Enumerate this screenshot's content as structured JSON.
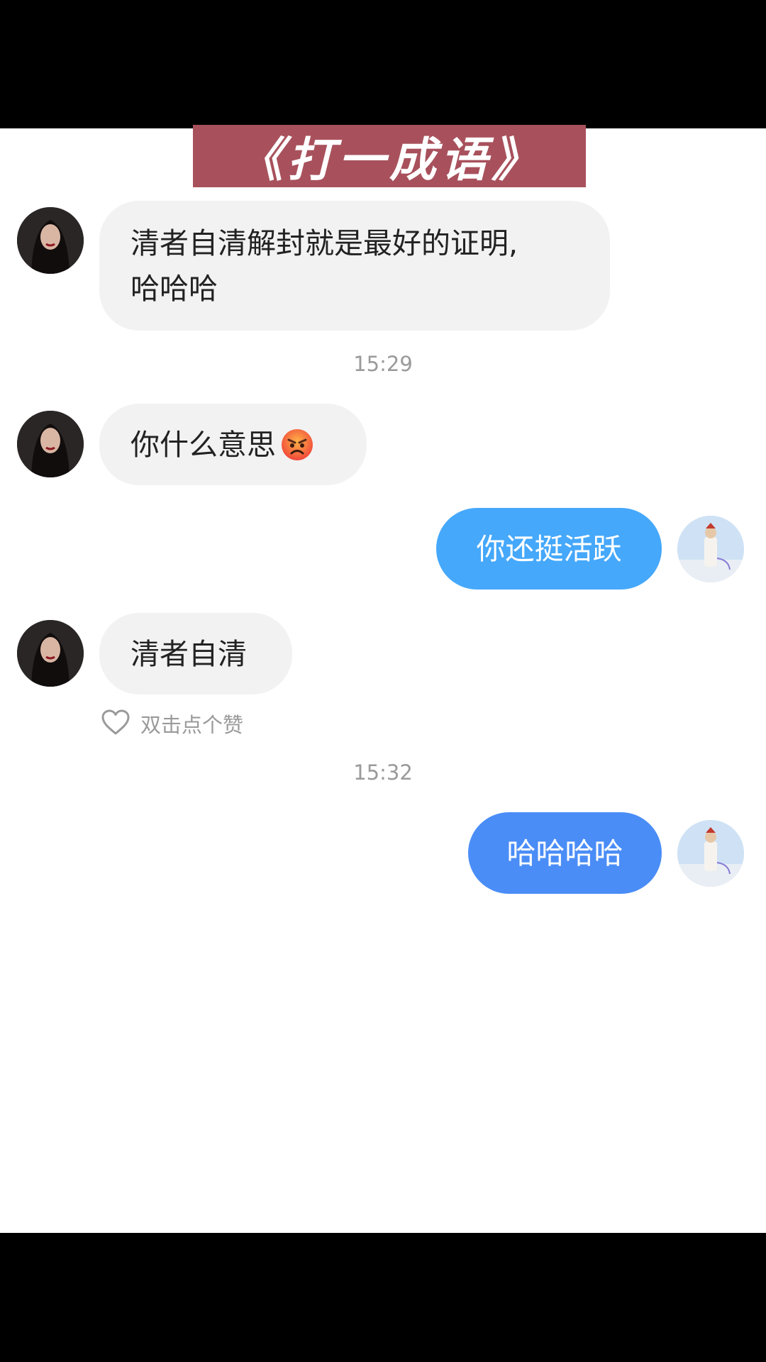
{
  "title": "《打一成语》",
  "colors": {
    "banner": "#a8515c",
    "incoming_bubble": "#f2f2f2",
    "outgoing_bubble_1": "#45a8fb",
    "outgoing_bubble_2": "#4a8df7",
    "timestamp": "#9a9a9a"
  },
  "messages": [
    {
      "side": "in",
      "line1": "清者自清解封就是最好的证明,",
      "line2": "哈哈哈"
    },
    {
      "side": "in",
      "text": "你什么意思",
      "emoji": "angry-face-icon"
    },
    {
      "side": "out",
      "text": "你还挺活跃"
    },
    {
      "side": "in",
      "text": "清者自清",
      "like_hint": "双击点个赞"
    },
    {
      "side": "out",
      "text": "哈哈哈哈"
    }
  ],
  "timestamps": [
    "15:29",
    "15:32"
  ],
  "like_icon": "heart-outline-icon"
}
